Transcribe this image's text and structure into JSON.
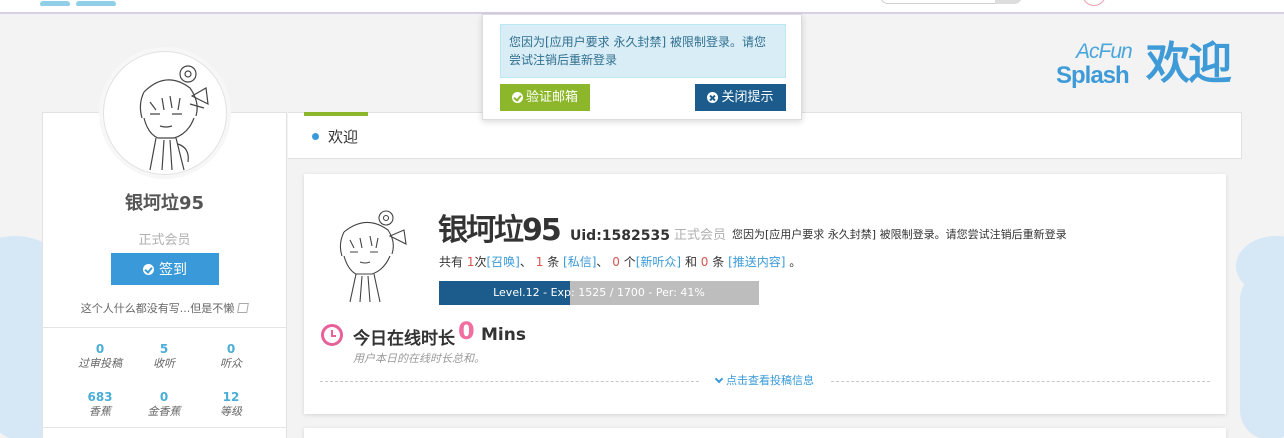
{
  "notice": {
    "message": "您因为[应用户要求 永久封禁] 被限制登录。请您尝试注销后重新登录",
    "verify_label": "验证邮箱",
    "close_label": "关闭提示"
  },
  "splash": {
    "acfun": "AcFun",
    "splash": "Splash",
    "welcome": "欢迎"
  },
  "sidebar": {
    "username": "银坷垃95",
    "rank": "正式会员",
    "signin_label": "签到",
    "signature": "这个人什么都没有写...但是不懒",
    "stats": [
      {
        "value": "0",
        "label": "过审投稿"
      },
      {
        "value": "5",
        "label": "收听"
      },
      {
        "value": "0",
        "label": "听众"
      },
      {
        "value": "683",
        "label": "香蕉"
      },
      {
        "value": "0",
        "label": "金香蕉"
      },
      {
        "value": "12",
        "label": "等级"
      }
    ]
  },
  "main": {
    "tab_title": "欢迎",
    "username": "银坷垃95",
    "uid": "Uid:1582535",
    "rank": "正式会员",
    "ban_text": "您因为[应用户要求 永久封禁] 被限制登录。请您尝试注销后重新登录",
    "stats": {
      "prefix": "共有",
      "summon_count": "1",
      "summon_unit": "次",
      "summon_label": "[召唤]",
      "sep1": "、",
      "pm_count": "1",
      "pm_unit": "条",
      "pm_label": "[私信]",
      "sep2": "、",
      "listener_count": "0",
      "listener_unit": "个",
      "listener_label": "[新听众]",
      "and": "和",
      "push_count": "0",
      "push_unit": "条",
      "push_label": "[推送内容]",
      "end": "。"
    },
    "level": {
      "text": "Level.12 - Exp: 1525 / 1700 - Per: 41%",
      "percent": 41
    },
    "online": {
      "label": "今日在线时长",
      "value": "0",
      "unit": "Mins",
      "desc": "用户本日的在线时长总和。"
    },
    "expand_label": "点击查看投稿信息"
  },
  "colors": {
    "accent_blue": "#3a9ad9",
    "accent_green": "#8db72b",
    "dark_blue": "#1b5c8c",
    "pink": "#f06ea0"
  }
}
